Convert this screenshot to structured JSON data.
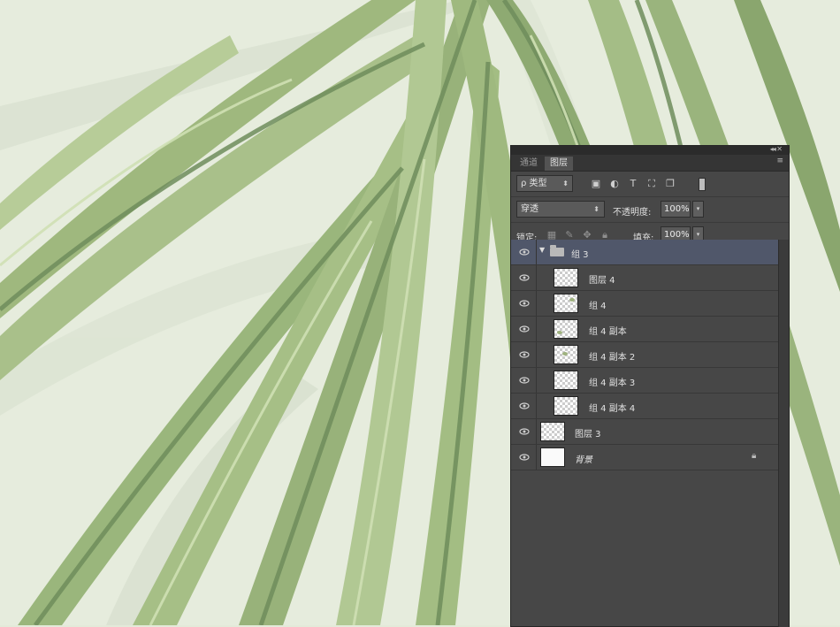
{
  "panel": {
    "tabs": [
      {
        "label": "通道",
        "active": false
      },
      {
        "label": "图层",
        "active": true
      }
    ],
    "filter": {
      "label": "类型"
    },
    "filter_icons": [
      "image-filter-icon",
      "adjustment-filter-icon",
      "type-filter-icon",
      "shape-filter-icon",
      "smart-object-filter-icon"
    ],
    "blend_mode": "穿透",
    "opacity_label": "不透明度:",
    "opacity_value": "100%",
    "lock_label": "锁定:",
    "fill_label": "填充:",
    "fill_value": "100%"
  },
  "layers": [
    {
      "name": "组 3",
      "type": "group",
      "expanded": true,
      "selected": true,
      "visible": true
    },
    {
      "name": "图层 4",
      "type": "layer",
      "visible": true
    },
    {
      "name": "组 4",
      "type": "group-thumb",
      "visible": true
    },
    {
      "name": "组 4 副本",
      "type": "group-thumb",
      "visible": true
    },
    {
      "name": "组 4 副本 2",
      "type": "group-thumb",
      "visible": true
    },
    {
      "name": "组 4 副本 3",
      "type": "layer",
      "visible": true
    },
    {
      "name": "组 4 副本 4",
      "type": "layer",
      "visible": true
    },
    {
      "name": "图层 3",
      "type": "layer",
      "visible": true
    },
    {
      "name": "背景",
      "type": "background",
      "visible": true,
      "locked": true
    }
  ],
  "colors": {
    "panel_bg": "#474747",
    "selected_row": "#50576a",
    "leaf_light": "#b7cc98",
    "leaf_mid": "#98b27a",
    "leaf_dark": "#6f8d5c",
    "canvas_bg": "#e3ead9"
  }
}
